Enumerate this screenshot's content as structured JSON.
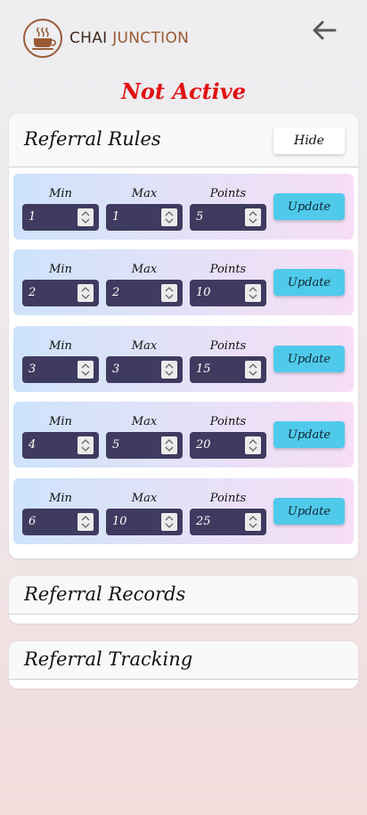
{
  "header": {
    "brand_part1": "CHAI",
    "brand_part2": "JUNCTION",
    "logo_icon": "tea-cup-icon",
    "back_icon": "arrow-left-icon"
  },
  "status": "Not Active",
  "rules_card": {
    "title": "Referral Rules",
    "hide_label": "Hide",
    "labels": {
      "min": "Min",
      "max": "Max",
      "points": "Points"
    },
    "update_label": "Update",
    "rows": [
      {
        "min": "1",
        "max": "1",
        "points": "5"
      },
      {
        "min": "2",
        "max": "2",
        "points": "10"
      },
      {
        "min": "3",
        "max": "3",
        "points": "15"
      },
      {
        "min": "4",
        "max": "5",
        "points": "20"
      },
      {
        "min": "6",
        "max": "10",
        "points": "25"
      }
    ]
  },
  "records_card": {
    "title": "Referral Records"
  },
  "tracking_card": {
    "title": "Referral Tracking"
  },
  "colors": {
    "status": "#e01010",
    "brand_accent": "#9a5a34",
    "input_bg": "#3f3a5f",
    "update_bg": "#4fcaea"
  }
}
